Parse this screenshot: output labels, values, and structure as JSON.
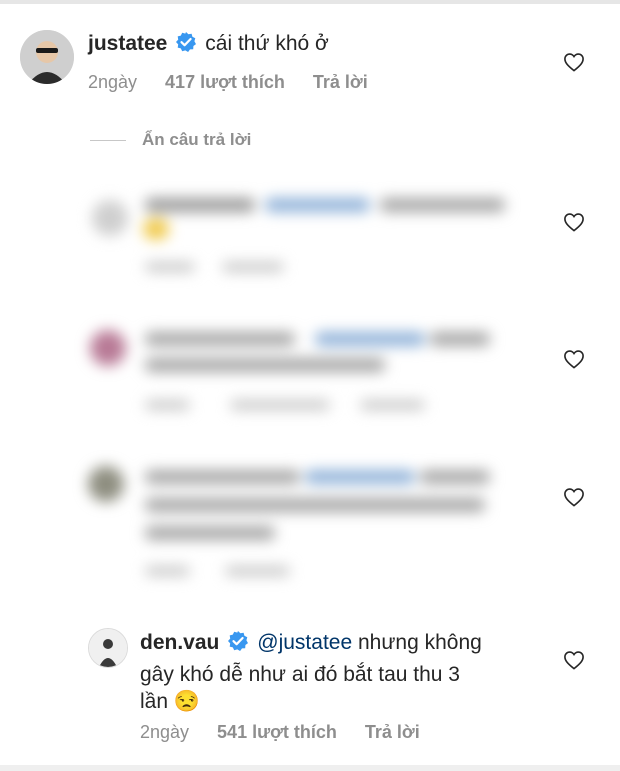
{
  "comment_top": {
    "username": "justatee",
    "text": "cái thứ khó ở",
    "time": "2ngày",
    "likes": "417 lượt thích",
    "reply": "Trả lời"
  },
  "hide_replies_label": "Ẩn câu trả lời",
  "comment_bottom": {
    "username": "den.vau",
    "mention": "@justatee",
    "text_line1": " nhưng không",
    "text_line2": "gây khó dễ như ai đó bắt tau thu 3",
    "text_line3": "lần 😒",
    "time": "2ngày",
    "likes": "541 lượt thích",
    "reply": "Trả lời"
  },
  "icons": {
    "verified": "verified-badge-icon",
    "like": "heart-icon",
    "color_verified": "#3897f0"
  }
}
